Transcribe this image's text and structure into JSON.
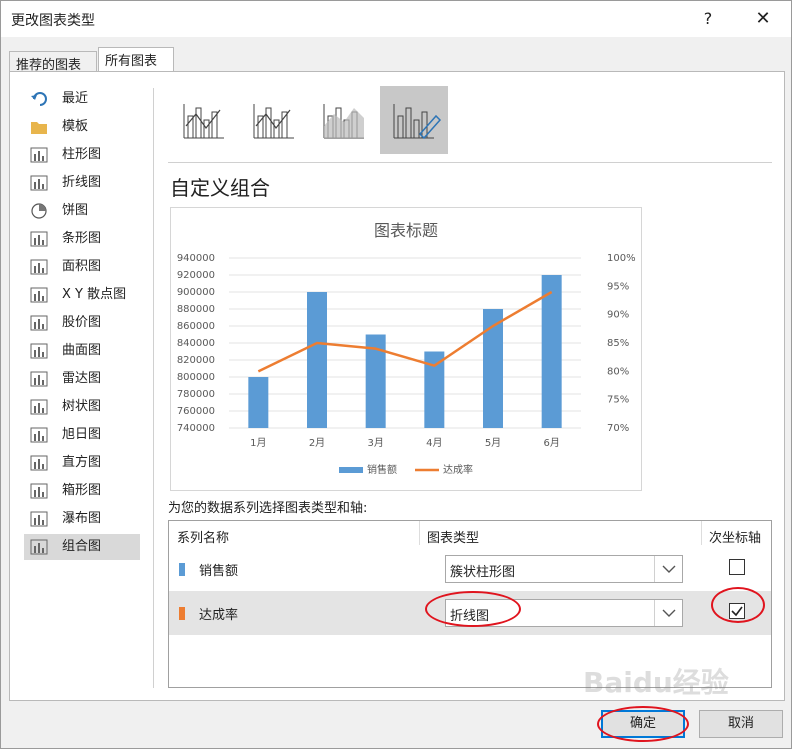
{
  "window": {
    "title": "更改图表类型",
    "help": "?",
    "close": "✕"
  },
  "tabs": [
    {
      "label": "推荐的图表"
    },
    {
      "label": "所有图表"
    }
  ],
  "categories": [
    {
      "label": "最近",
      "icon": "undo-icon"
    },
    {
      "label": "模板",
      "icon": "folder-icon"
    },
    {
      "label": "柱形图",
      "icon": "column-chart-icon"
    },
    {
      "label": "折线图",
      "icon": "line-chart-icon"
    },
    {
      "label": "饼图",
      "icon": "pie-chart-icon"
    },
    {
      "label": "条形图",
      "icon": "bar-chart-icon"
    },
    {
      "label": "面积图",
      "icon": "area-chart-icon"
    },
    {
      "label": "X Y 散点图",
      "icon": "scatter-chart-icon"
    },
    {
      "label": "股价图",
      "icon": "stock-chart-icon"
    },
    {
      "label": "曲面图",
      "icon": "surface-chart-icon"
    },
    {
      "label": "雷达图",
      "icon": "radar-chart-icon"
    },
    {
      "label": "树状图",
      "icon": "treemap-chart-icon"
    },
    {
      "label": "旭日图",
      "icon": "sunburst-chart-icon"
    },
    {
      "label": "直方图",
      "icon": "histogram-chart-icon"
    },
    {
      "label": "箱形图",
      "icon": "box-whisker-chart-icon"
    },
    {
      "label": "瀑布图",
      "icon": "waterfall-chart-icon"
    },
    {
      "label": "组合图",
      "icon": "combo-chart-icon",
      "selected": true
    }
  ],
  "subtypes": [
    {
      "icon": "combo-column-line-icon"
    },
    {
      "icon": "combo-column-line-secondary-icon"
    },
    {
      "icon": "combo-area-column-icon"
    },
    {
      "icon": "custom-combo-icon",
      "selected": true
    }
  ],
  "heading": "自定义组合",
  "chart_data": {
    "type": "bar",
    "title": "图表标题",
    "categories": [
      "1月",
      "2月",
      "3月",
      "4月",
      "5月",
      "6月"
    ],
    "series": [
      {
        "name": "销售额",
        "type": "bar",
        "axis": "primary",
        "color": "#5b9bd5",
        "values": [
          800000,
          900000,
          850000,
          830000,
          880000,
          920000
        ]
      },
      {
        "name": "达成率",
        "type": "line",
        "axis": "secondary",
        "color": "#ed7d31",
        "values": [
          0.8,
          0.85,
          0.84,
          0.81,
          0.88,
          0.94
        ]
      }
    ],
    "ylim": [
      740000,
      940000
    ],
    "y_ticks": [
      "940000",
      "920000",
      "900000",
      "880000",
      "860000",
      "840000",
      "820000",
      "800000",
      "780000",
      "760000",
      "740000"
    ],
    "y2lim": [
      0.7,
      1.0
    ],
    "y2_ticks": [
      "100%",
      "95%",
      "90%",
      "85%",
      "80%",
      "75%",
      "70%"
    ],
    "grid": true,
    "legend": "bottom"
  },
  "instruction": "为您的数据系列选择图表类型和轴:",
  "grid_headers": {
    "name": "系列名称",
    "type": "图表类型",
    "secondary": "次坐标轴"
  },
  "series_rows": [
    {
      "name": "销售额",
      "color": "#5b9bd5",
      "chart_type": "簇状柱形图",
      "secondary": false
    },
    {
      "name": "达成率",
      "color": "#ed7d31",
      "chart_type": "折线图",
      "secondary": true
    }
  ],
  "buttons": {
    "ok": "确定",
    "cancel": "取消"
  },
  "annotation_color": "#e0141e",
  "watermark": "Baidu经验"
}
